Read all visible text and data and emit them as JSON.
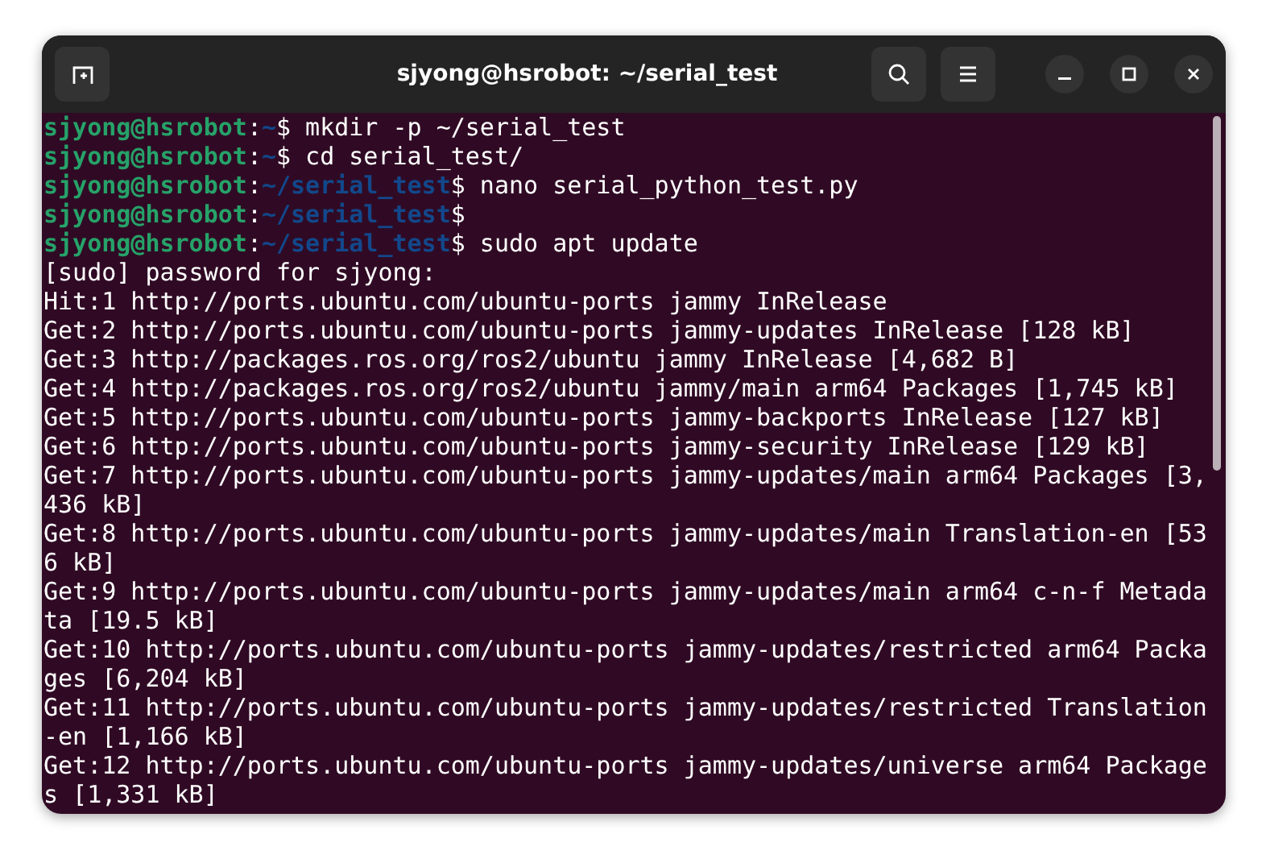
{
  "window": {
    "title": "sjyong@hsrobot: ~/serial_test"
  },
  "terminal": {
    "lines": [
      {
        "kind": "prompt",
        "user": "sjyong@hsrobot",
        "colon": ":",
        "path": "~",
        "command": "$ mkdir -p ~/serial_test"
      },
      {
        "kind": "prompt",
        "user": "sjyong@hsrobot",
        "colon": ":",
        "path": "~",
        "command": "$ cd serial_test/"
      },
      {
        "kind": "prompt",
        "user": "sjyong@hsrobot",
        "colon": ":",
        "path": "~/serial_test",
        "command": "$ nano serial_python_test.py"
      },
      {
        "kind": "prompt",
        "user": "sjyong@hsrobot",
        "colon": ":",
        "path": "~/serial_test",
        "command": "$"
      },
      {
        "kind": "prompt",
        "user": "sjyong@hsrobot",
        "colon": ":",
        "path": "~/serial_test",
        "command": "$ sudo apt update"
      },
      {
        "kind": "output",
        "text": "[sudo] password for sjyong:"
      },
      {
        "kind": "output",
        "text": "Hit:1 http://ports.ubuntu.com/ubuntu-ports jammy InRelease"
      },
      {
        "kind": "output",
        "text": "Get:2 http://ports.ubuntu.com/ubuntu-ports jammy-updates InRelease [128 kB]"
      },
      {
        "kind": "output",
        "text": "Get:3 http://packages.ros.org/ros2/ubuntu jammy InRelease [4,682 B]"
      },
      {
        "kind": "output",
        "text": "Get:4 http://packages.ros.org/ros2/ubuntu jammy/main arm64 Packages [1,745 kB]"
      },
      {
        "kind": "output",
        "text": "Get:5 http://ports.ubuntu.com/ubuntu-ports jammy-backports InRelease [127 kB]"
      },
      {
        "kind": "output",
        "text": "Get:6 http://ports.ubuntu.com/ubuntu-ports jammy-security InRelease [129 kB]"
      },
      {
        "kind": "output",
        "text": "Get:7 http://ports.ubuntu.com/ubuntu-ports jammy-updates/main arm64 Packages [3,"
      },
      {
        "kind": "output",
        "text": "436 kB]"
      },
      {
        "kind": "output",
        "text": "Get:8 http://ports.ubuntu.com/ubuntu-ports jammy-updates/main Translation-en [53"
      },
      {
        "kind": "output",
        "text": "6 kB]"
      },
      {
        "kind": "output",
        "text": "Get:9 http://ports.ubuntu.com/ubuntu-ports jammy-updates/main arm64 c-n-f Metada"
      },
      {
        "kind": "output",
        "text": "ta [19.5 kB]"
      },
      {
        "kind": "output",
        "text": "Get:10 http://ports.ubuntu.com/ubuntu-ports jammy-updates/restricted arm64 Packa"
      },
      {
        "kind": "output",
        "text": "ges [6,204 kB]"
      },
      {
        "kind": "output",
        "text": "Get:11 http://ports.ubuntu.com/ubuntu-ports jammy-updates/restricted Translation"
      },
      {
        "kind": "output",
        "text": "-en [1,166 kB]"
      },
      {
        "kind": "output",
        "text": "Get:12 http://ports.ubuntu.com/ubuntu-ports jammy-updates/universe arm64 Package"
      },
      {
        "kind": "output",
        "text": "s [1,331 kB]"
      }
    ]
  }
}
